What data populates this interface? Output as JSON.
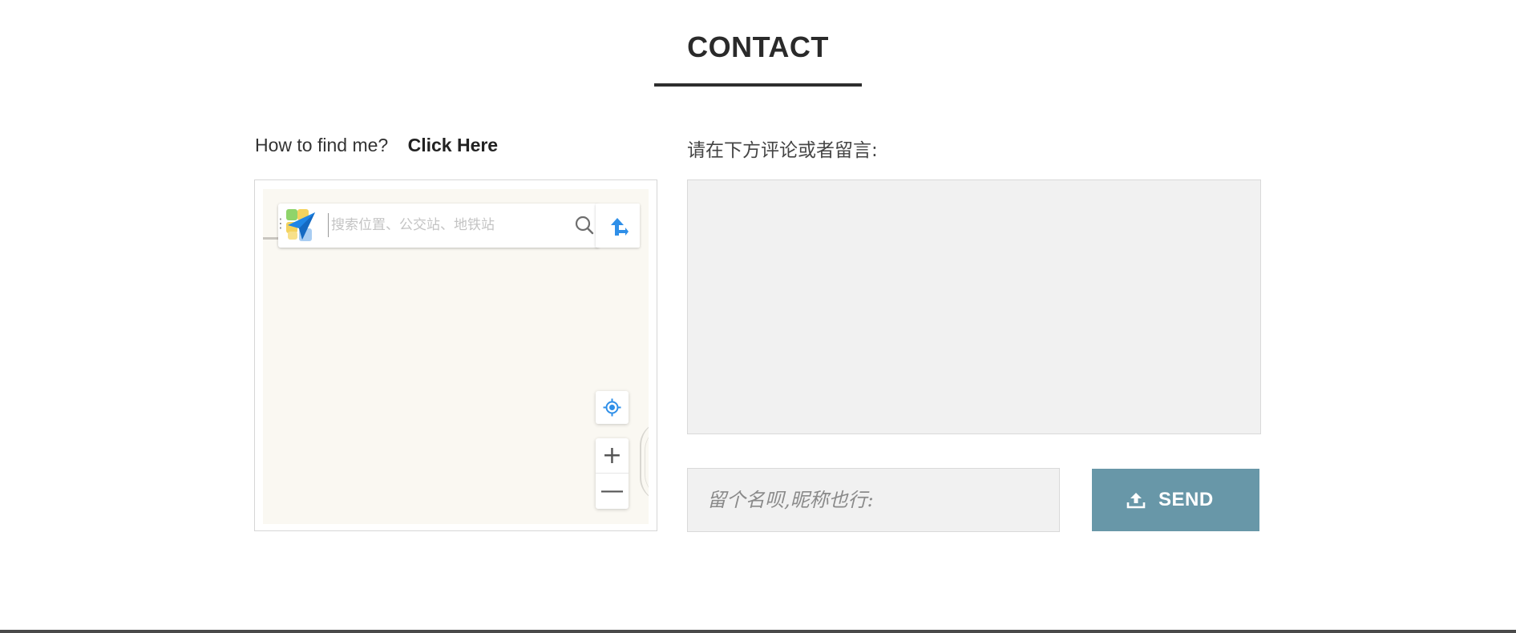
{
  "section": {
    "title": "CONTACT"
  },
  "find": {
    "question": "How to find me?",
    "link_label": "Click Here"
  },
  "map": {
    "search_placeholder": "搜索位置、公交站、地铁站",
    "zoom_in_label": "+",
    "zoom_out_label": "—",
    "accent_color": "#2f8fe8"
  },
  "comment": {
    "label": "请在下方评论或者留言:",
    "name_placeholder": "留个名呗,昵称也行:",
    "send_label": "SEND",
    "send_color": "#6897a8"
  }
}
